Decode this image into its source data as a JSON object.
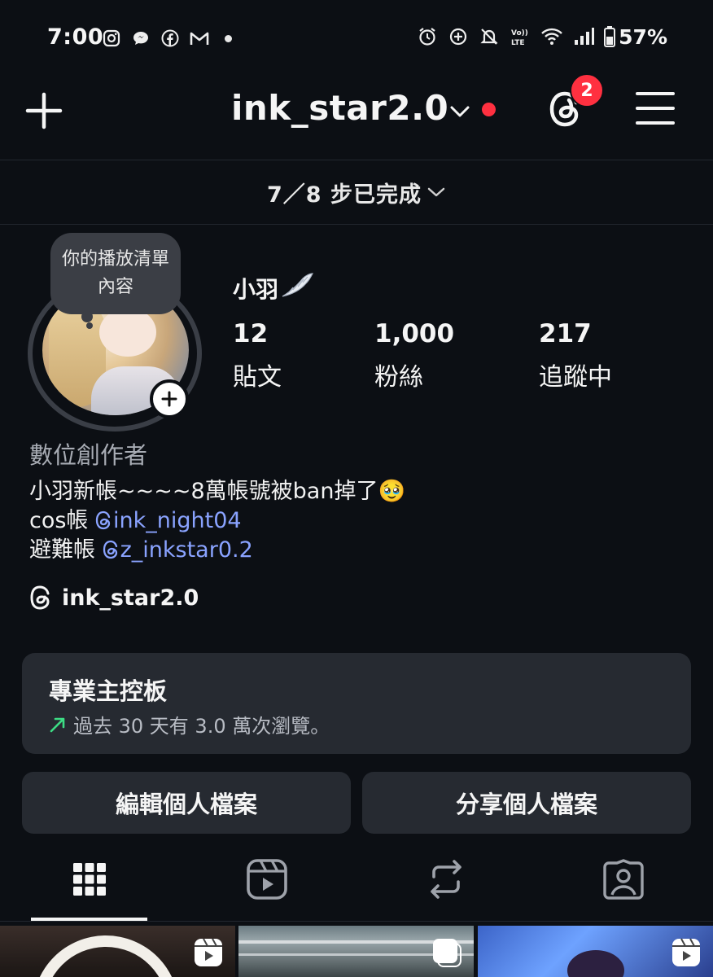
{
  "status_bar": {
    "time": "7:00",
    "battery": "57%",
    "left_icons": [
      "instagram-icon",
      "chat-bubble-icon",
      "facebook-icon",
      "gmail-icon",
      "dot-icon"
    ],
    "right_icons": [
      "alarm-icon",
      "data-saver-icon",
      "mute-icon",
      "volte-icon",
      "wifi-icon",
      "signal-icon",
      "battery-icon"
    ]
  },
  "header": {
    "username": "ink_star2.0",
    "threads_badge": "2"
  },
  "setup_progress": {
    "text": "7／8 步已完成"
  },
  "profile": {
    "note": "你的播放清單內容",
    "display_name": "小羽",
    "stats": [
      {
        "value": "12",
        "label": "貼文"
      },
      {
        "value": "1,000",
        "label": "粉絲"
      },
      {
        "value": "217",
        "label": "追蹤中"
      }
    ],
    "category": "數位創作者",
    "bio_line1": "小羽新帳~~~~8萬帳號被ban掉了🥹",
    "bio_line2_prefix": "cos帳",
    "bio_line2_mention": "ink_night04",
    "bio_line3_prefix": "避難帳",
    "bio_line3_mention": "z_inkstar0.2",
    "threads_handle": "ink_star2.0"
  },
  "dashboard": {
    "title": "專業主控板",
    "subtitle": "過去 30 天有 3.0 萬次瀏覽。",
    "trend_color": "#3ddc84"
  },
  "buttons": {
    "edit_profile": "編輯個人檔案",
    "share_profile": "分享個人檔案"
  },
  "tabs": [
    "grid-icon",
    "reels-icon",
    "reposts-icon",
    "tagged-icon"
  ],
  "colors": {
    "background": "#0c0f14",
    "accent_red": "#ff3040",
    "mention_blue": "#8aa3ff",
    "card": "#262a31"
  }
}
